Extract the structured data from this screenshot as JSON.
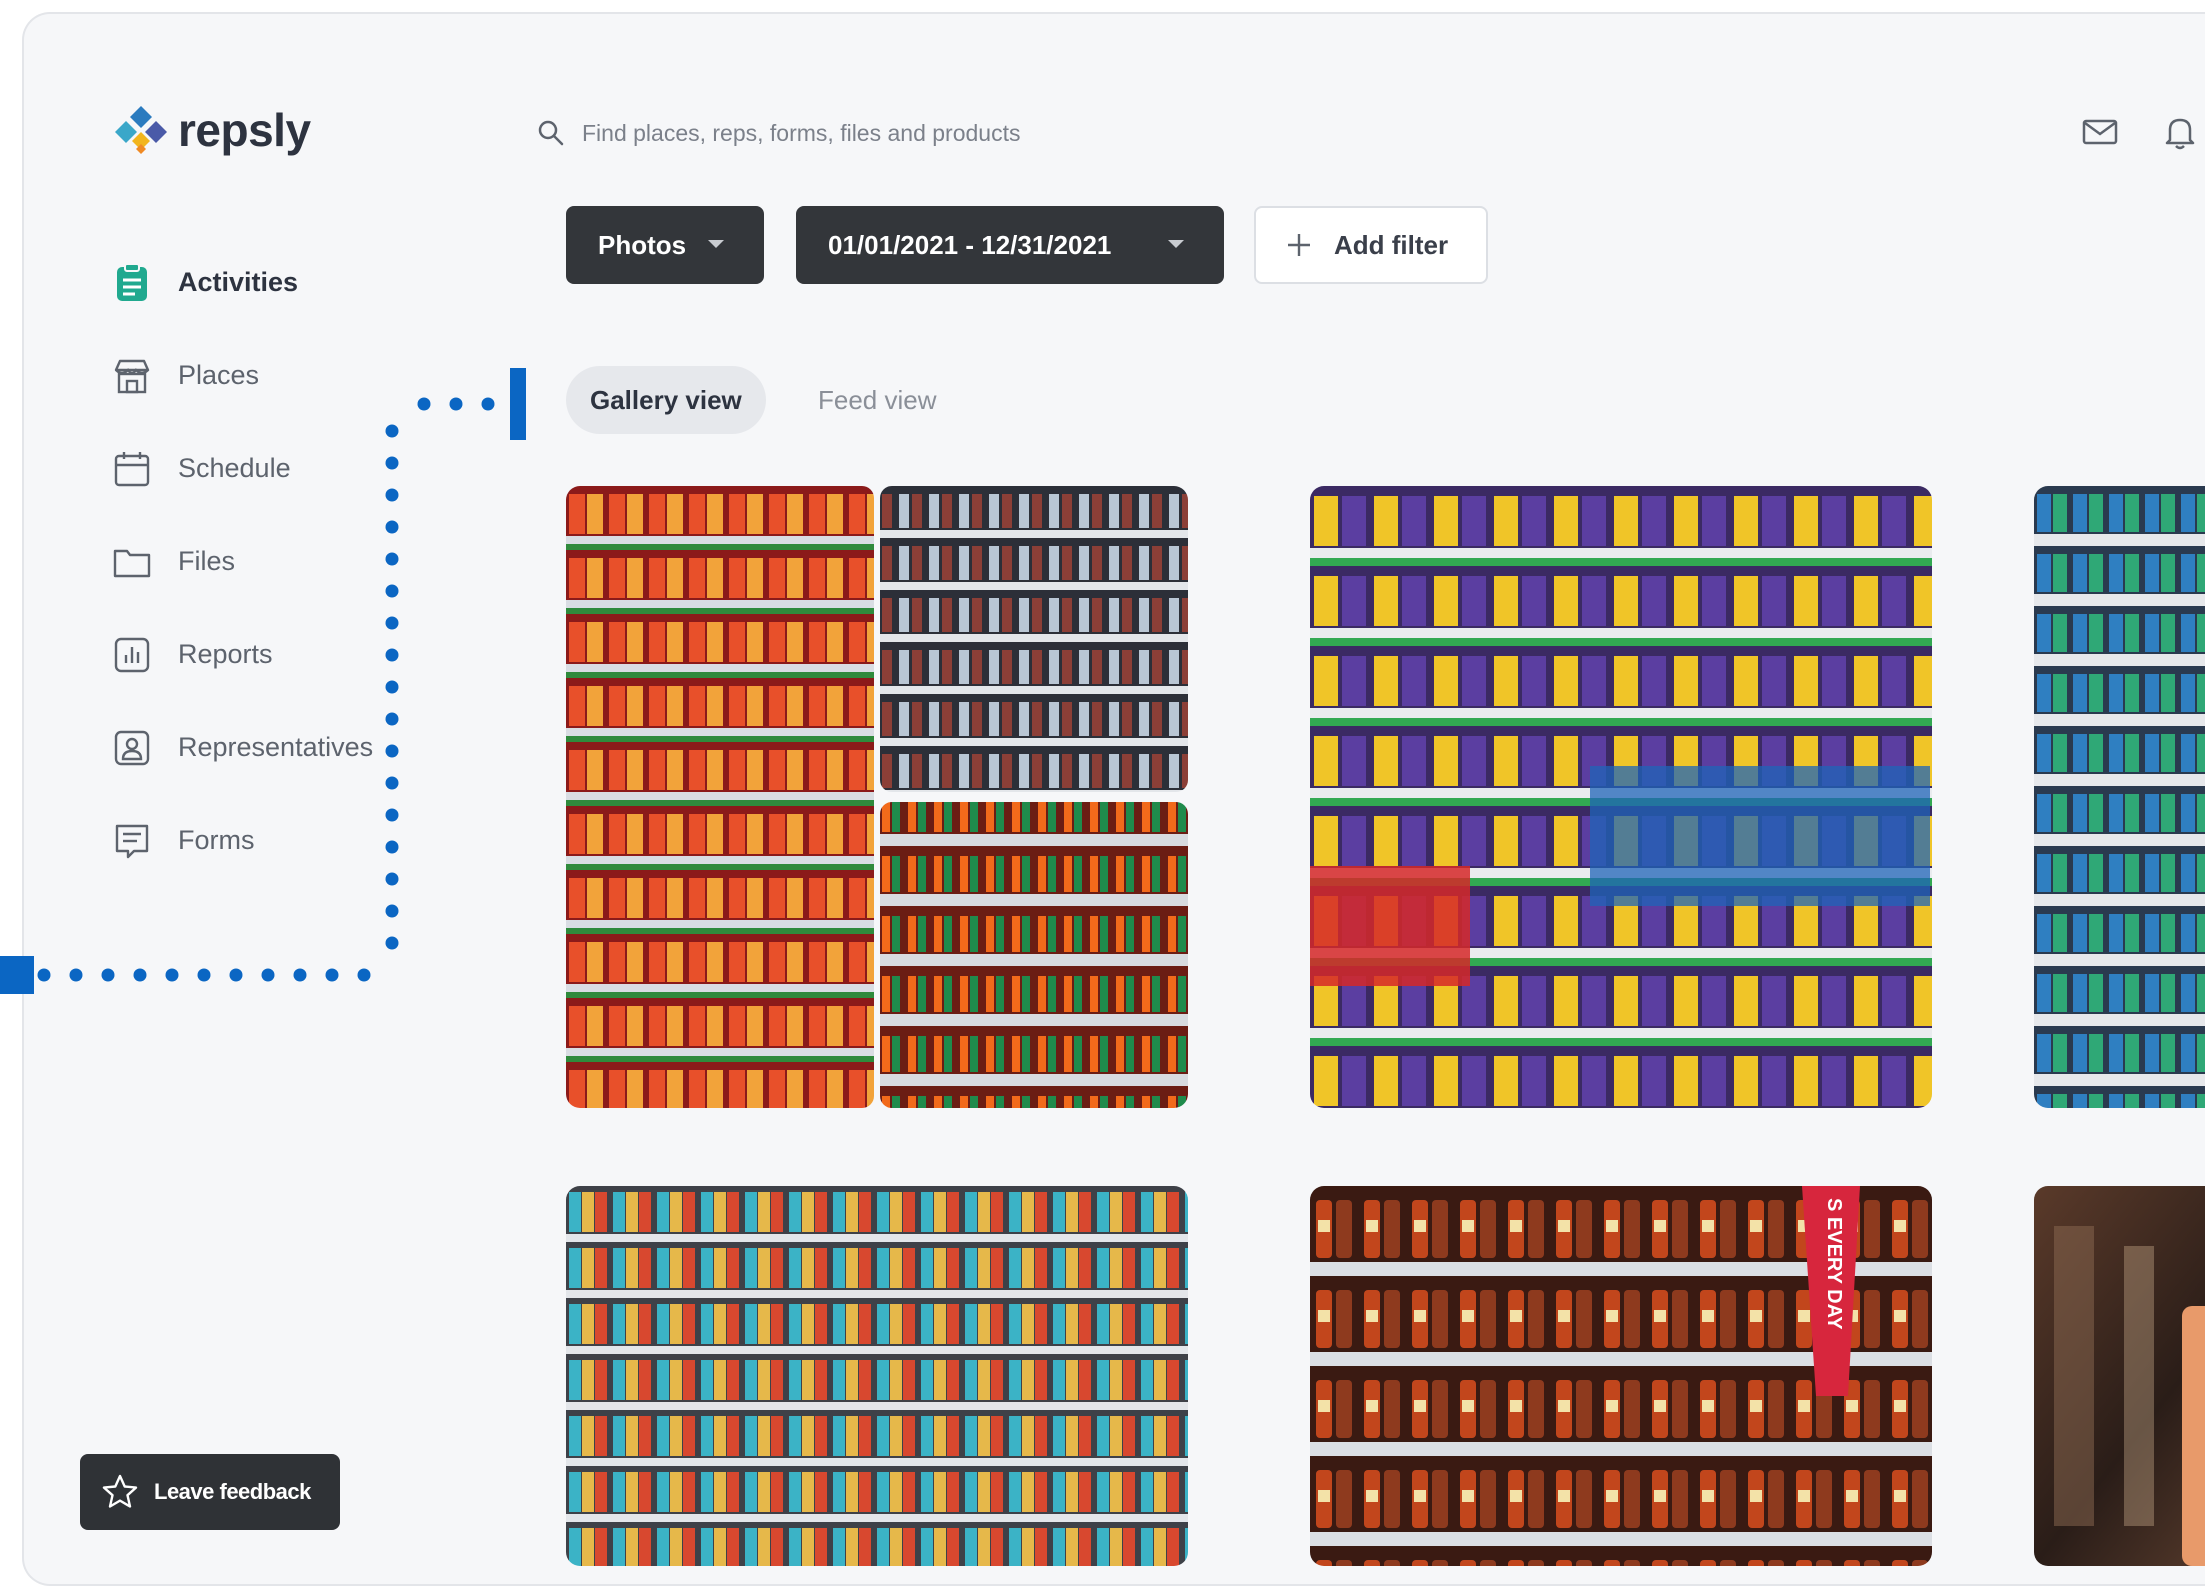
{
  "app": {
    "brand": "repsly"
  },
  "search": {
    "placeholder": "Find places, reps, forms, files and products"
  },
  "top_icons": [
    "mail-icon",
    "bell-icon"
  ],
  "sidebar": {
    "items": [
      {
        "label": "Activities",
        "icon": "activities-icon",
        "active": true
      },
      {
        "label": "Places",
        "icon": "store-icon"
      },
      {
        "label": "Schedule",
        "icon": "calendar-icon"
      },
      {
        "label": "Files",
        "icon": "folder-icon"
      },
      {
        "label": "Reports",
        "icon": "report-chart-icon"
      },
      {
        "label": "Representatives",
        "icon": "user-badge-icon"
      },
      {
        "label": "Forms",
        "icon": "form-icon"
      }
    ],
    "feedback_label": "Leave feedback"
  },
  "filters": {
    "type_label": "Photos",
    "date_range": "01/01/2021 - 12/31/2021",
    "add_filter_label": "Add filter"
  },
  "views": {
    "gallery": "Gallery view",
    "feed": "Feed view",
    "active": "gallery"
  },
  "gallery": {
    "photos": [
      {
        "name": "collage-shelves-canned-drinks"
      },
      {
        "name": "confectionery-easter-eggs-shelf"
      },
      {
        "name": "grocery-aisle-packaged-goods"
      },
      {
        "name": "canned-fish-shelf"
      },
      {
        "name": "juice-bottles-shelf"
      },
      {
        "name": "beverage-bottles-closeup"
      }
    ],
    "sign_text": "S EVERY DAY"
  },
  "colors": {
    "accent_teal": "#20a98f",
    "connector_blue": "#0b66c3",
    "dark_button": "#33363a",
    "logo_blue": "#2b7bbf",
    "logo_yellow": "#f2b51d"
  }
}
